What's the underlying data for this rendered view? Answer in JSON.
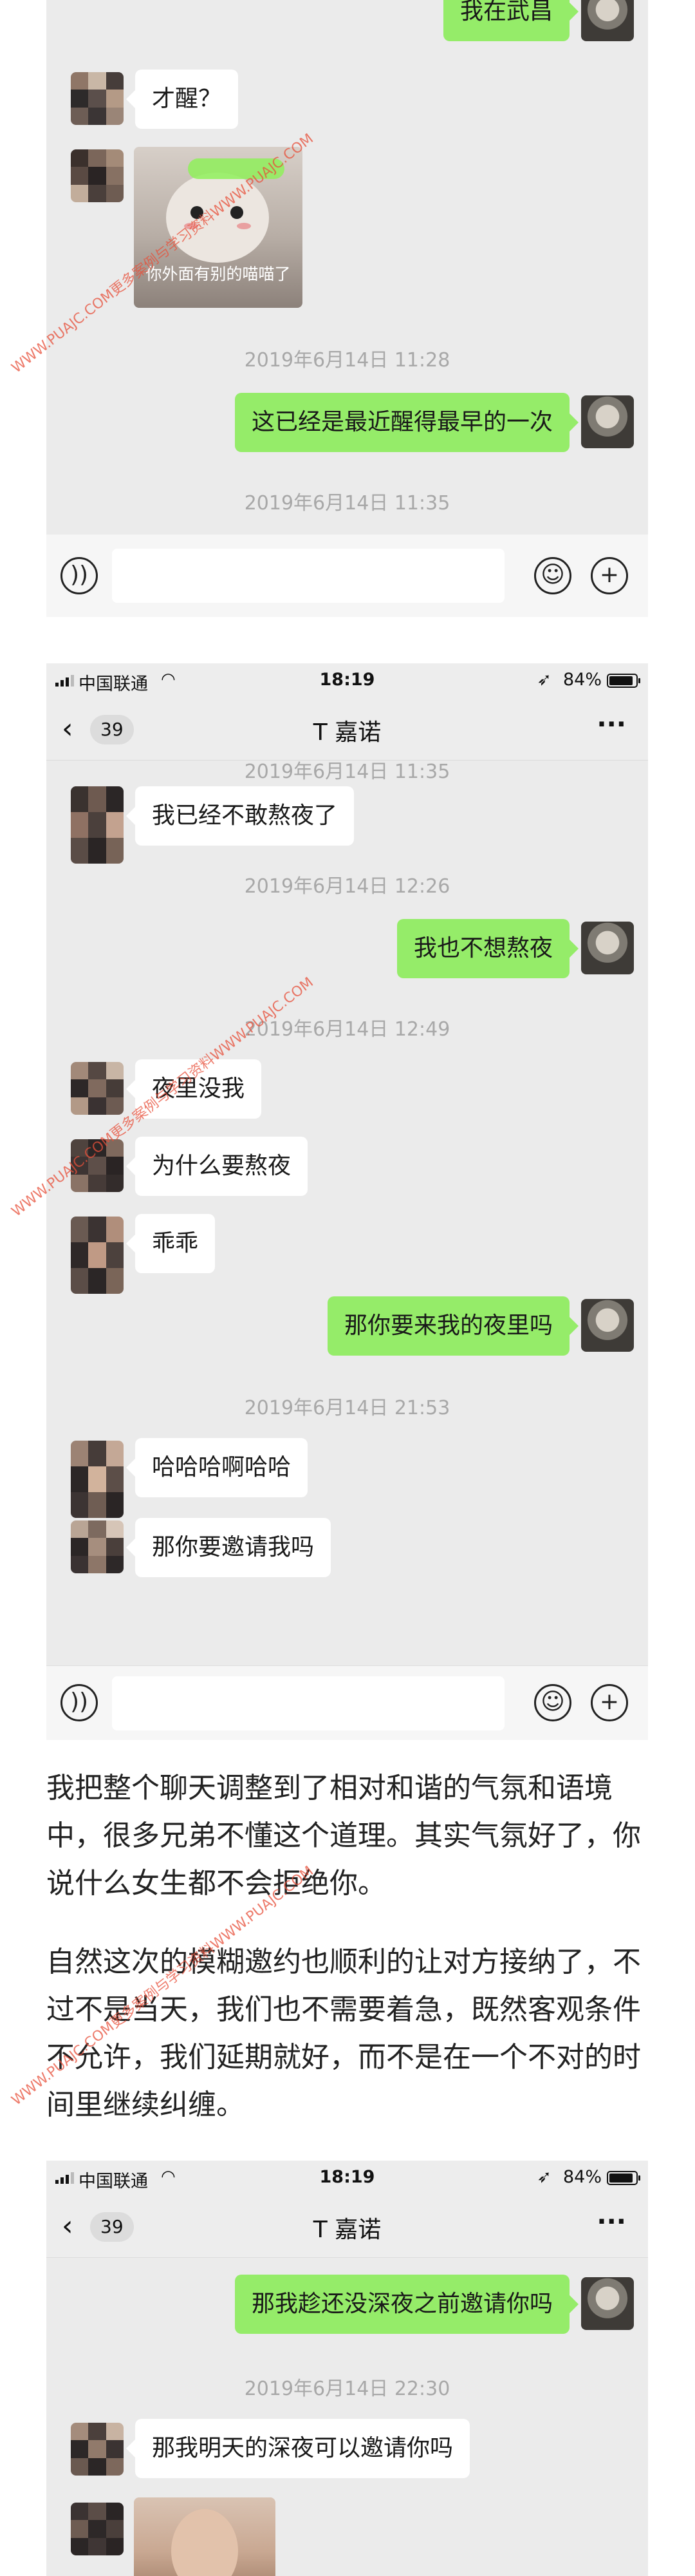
{
  "status_bar": {
    "carrier": "中国联通",
    "time": "18:19",
    "battery": "84%"
  },
  "nav": {
    "back_count": "39",
    "title": "T 嘉诺",
    "more": "···"
  },
  "shot1": {
    "msg_top": "我在武昌",
    "msg_wake": "才醒？",
    "sticker_caption": "你外面有别的喵喵了",
    "ts1": "2019年6月14日 11:28",
    "msg_earliest": "这已经是最近醒得最早的一次",
    "ts2": "2019年6月14日 11:35"
  },
  "shot2": {
    "ts_partial": "2019年6月14日 11:35",
    "m1": "我已经不敢熬夜了",
    "ts1": "2019年6月14日 12:26",
    "m2": "我也不想熬夜",
    "ts2": "2019年6月14日 12:49",
    "m3": "夜里没我",
    "m4": "为什么要熬夜",
    "m5": "乖乖",
    "m6": "那你要来我的夜里吗",
    "ts3": "2019年6月14日 21:53",
    "m7": "哈哈哈啊哈哈",
    "m8": "那你要邀请我吗"
  },
  "article": {
    "p1": "我把整个聊天调整到了相对和谐的气氛和语境中，很多兄弟不懂这个道理。其实气氛好了，你说什么女生都不会拒绝你。",
    "p2": "自然这次的模糊邀约也顺利的让对方接纳了，不过不是当天，我们也不需要着急，既然客观条件不允许，我们延期就好，而不是在一个不对的时间里继续纠缠。"
  },
  "shot3": {
    "m1": "那我趁还没深夜之前邀请你吗",
    "ts1": "2019年6月14日 22:30",
    "m2": "那我明天的深夜可以邀请你吗"
  },
  "watermark": "WWW.PUAJC.COM更多案例与学习资料WWW.PUAJC.COM",
  "icons": [
    "voice-icon",
    "emoji-icon",
    "plus-icon",
    "back-chevron-icon",
    "wifi-icon",
    "signal-icon",
    "location-arrow-icon",
    "battery-icon"
  ]
}
